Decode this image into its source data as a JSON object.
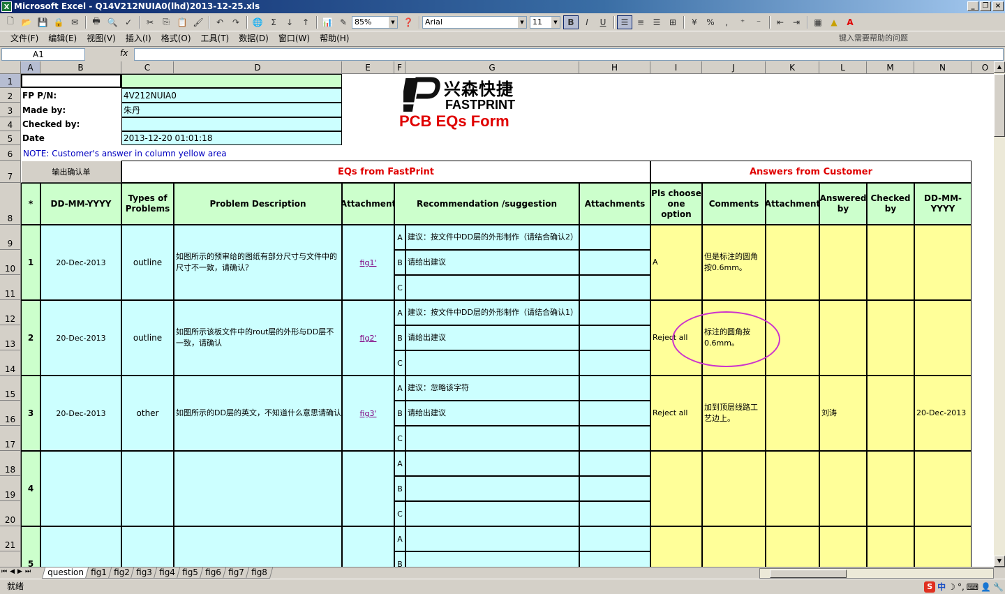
{
  "window": {
    "title": "Microsoft Excel - Q14V212NUIA0(lhd)2013-12-25.xls",
    "app_icon": "X"
  },
  "toolbar": {
    "zoom": "85%",
    "font_name": "Arial",
    "font_size": "11",
    "bold": "B",
    "italic": "I",
    "underline": "U",
    "sigma": "Σ",
    "percent": "%",
    "comma": ","
  },
  "menu": {
    "items": [
      "文件(F)",
      "编辑(E)",
      "视图(V)",
      "插入(I)",
      "格式(O)",
      "工具(T)",
      "数据(D)",
      "窗口(W)",
      "帮助(H)"
    ],
    "help_placeholder": "键入需要帮助的问题"
  },
  "formula": {
    "name_box": "A1",
    "fx": "fx",
    "content": ""
  },
  "columns": [
    "A",
    "B",
    "C",
    "D",
    "E",
    "F",
    "G",
    "H",
    "I",
    "J",
    "K",
    "L",
    "M",
    "N",
    "O"
  ],
  "rows": [
    "1",
    "2",
    "3",
    "4",
    "5",
    "6",
    "7",
    "8",
    "9",
    "10",
    "11",
    "12",
    "13",
    "14",
    "15",
    "16",
    "17",
    "18",
    "19",
    "20",
    "21"
  ],
  "form": {
    "fp_label": "FP P/N:",
    "fp_value": "4V212NUIA0",
    "made_label": "Made by:",
    "made_value": "朱丹",
    "checked_label": "Checked by:",
    "checked_value": "",
    "date_label": "Date",
    "date_value": "2013-12-20 01:01:18",
    "note": "NOTE: Customer's  answer in column yellow area",
    "export_button": "输出确认单",
    "logo_cn": "兴森快捷",
    "logo_en": "FASTPRINT",
    "title": "PCB EQs Form",
    "eqs_header": "EQs from FastPrint",
    "answers_header": "Answers from Customer"
  },
  "table_headers": {
    "star": "*",
    "date": "DD-MM-YYYY",
    "types": "Types of Problems",
    "desc": "Problem Description",
    "attach": "Attachment",
    "rec": "Recommendation /suggestion",
    "attachments": "Attachments",
    "choose": "Pls choose one option",
    "comments": "Comments",
    "attachment2": "Attachment",
    "answered": "Answered by",
    "checked": "Checked by",
    "date2": "DD-MM-YYYY"
  },
  "eqs": [
    {
      "no": "1",
      "date": "20-Dec-2013",
      "type": "outline",
      "desc": "如图所示的预审给的图纸有部分尺寸与文件中的尺寸不一致，请确认？",
      "attach": "fig1'",
      "recA": "建议：按文件中DD层的外形制作（请结合确认2）",
      "recB": "请给出建议",
      "recC": "",
      "choice": "A",
      "comment": "但是标注的圆角按0.6mm。",
      "answered": "",
      "date2": ""
    },
    {
      "no": "2",
      "date": "20-Dec-2013",
      "type": "outline",
      "desc": "如图所示该板文件中的rout层的外形与DD层不一致，请确认",
      "attach": "fig2'",
      "recA": "建议：按文件中DD层的外形制作（请结合确认1）",
      "recB": "请给出建议",
      "recC": "",
      "choice": "Reject all",
      "comment": "标注的圆角按0.6mm。",
      "answered": "",
      "date2": ""
    },
    {
      "no": "3",
      "date": "20-Dec-2013",
      "type": "other",
      "desc": "如图所示的DD层的英文，不知道什么意思请确认",
      "attach": "fig3'",
      "recA": "建议：忽略该字符",
      "recB": "请给出建议",
      "recC": "",
      "choice": "Reject all",
      "comment": "加到顶层线路工艺边上。",
      "answered": "刘涛",
      "date2": "20-Dec-2013"
    },
    {
      "no": "4",
      "date": "",
      "type": "",
      "desc": "",
      "attach": "",
      "recA": "",
      "recB": "",
      "recC": "",
      "choice": "",
      "comment": "",
      "answered": "",
      "date2": ""
    },
    {
      "no": "5"
    }
  ],
  "opt_labels": [
    "A",
    "B",
    "C"
  ],
  "tabs": [
    "question",
    "fig1",
    "fig2",
    "fig3",
    "fig4",
    "fig5",
    "fig6",
    "fig7",
    "fig8"
  ],
  "status": {
    "text": "就绪",
    "ime": "中"
  },
  "colors": {
    "green": "#ccffcc",
    "cyan": "#ccffff",
    "yellow": "#ffff99",
    "red": "#e00000",
    "circle": "#cc33cc"
  }
}
